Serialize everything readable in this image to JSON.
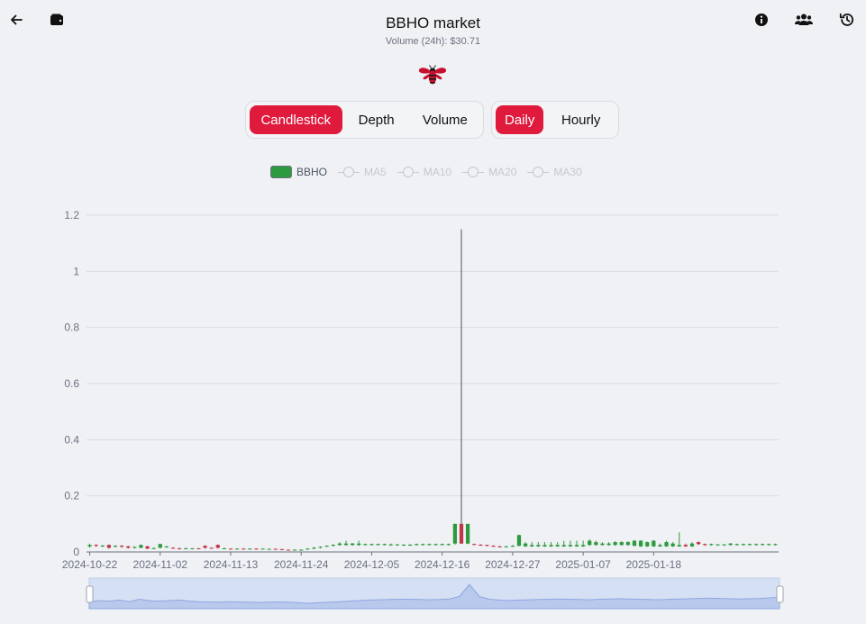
{
  "header": {
    "title": "BBHO market",
    "volume_label": "Volume (24h): $30.71"
  },
  "icons": {
    "back": "arrow-left-icon",
    "wallet": "wallet-icon",
    "info": "info-icon",
    "users": "users-icon",
    "history": "history-icon",
    "logo": "bee-logo-icon"
  },
  "chart_tabs": [
    {
      "label": "Candlestick",
      "active": true
    },
    {
      "label": "Depth",
      "active": false
    },
    {
      "label": "Volume",
      "active": false
    }
  ],
  "interval_tabs": [
    {
      "label": "Daily",
      "active": true
    },
    {
      "label": "Hourly",
      "active": false
    }
  ],
  "legend": [
    {
      "label": "BBHO",
      "active": true
    },
    {
      "label": "MA5",
      "active": false
    },
    {
      "label": "MA10",
      "active": false
    },
    {
      "label": "MA20",
      "active": false
    },
    {
      "label": "MA30",
      "active": false
    }
  ],
  "colors": {
    "accent": "#e01a3c",
    "up": "#2d9a3e",
    "down": "#c2354d"
  },
  "chart_data": {
    "type": "candlestick",
    "y_ticks": [
      "0",
      "0.2",
      "0.4",
      "0.6",
      "0.8",
      "1",
      "1.2"
    ],
    "ylim": [
      0,
      1.2
    ],
    "x_start": "2024-10-22",
    "x_ticks": [
      "2024-10-22",
      "2024-11-02",
      "2024-11-13",
      "2024-11-24",
      "2024-12-05",
      "2024-12-16",
      "2024-12-27",
      "2025-01-07",
      "2025-01-18"
    ],
    "candles": [
      [
        0.02,
        0.025,
        0.03,
        0.015
      ],
      [
        0.025,
        0.022,
        0.028,
        0.018
      ],
      [
        0.02,
        0.023,
        0.025,
        0.017
      ],
      [
        0.025,
        0.015,
        0.027,
        0.012
      ],
      [
        0.02,
        0.022,
        0.024,
        0.016
      ],
      [
        0.022,
        0.02,
        0.025,
        0.015
      ],
      [
        0.02,
        0.015,
        0.022,
        0.012
      ],
      [
        0.015,
        0.018,
        0.02,
        0.012
      ],
      [
        0.015,
        0.025,
        0.027,
        0.013
      ],
      [
        0.02,
        0.012,
        0.022,
        0.01
      ],
      [
        0.012,
        0.014,
        0.016,
        0.01
      ],
      [
        0.015,
        0.028,
        0.03,
        0.013
      ],
      [
        0.018,
        0.02,
        0.022,
        0.015
      ],
      [
        0.015,
        0.014,
        0.017,
        0.012
      ],
      [
        0.013,
        0.012,
        0.015,
        0.01
      ],
      [
        0.012,
        0.013,
        0.015,
        0.01
      ],
      [
        0.012,
        0.013,
        0.014,
        0.01
      ],
      [
        0.013,
        0.012,
        0.014,
        0.01
      ],
      [
        0.022,
        0.015,
        0.024,
        0.012
      ],
      [
        0.015,
        0.014,
        0.016,
        0.012
      ],
      [
        0.025,
        0.015,
        0.027,
        0.012
      ],
      [
        0.012,
        0.013,
        0.015,
        0.01
      ],
      [
        0.012,
        0.011,
        0.013,
        0.009
      ],
      [
        0.011,
        0.012,
        0.013,
        0.009
      ],
      [
        0.012,
        0.011,
        0.013,
        0.009
      ],
      [
        0.011,
        0.012,
        0.013,
        0.009
      ],
      [
        0.012,
        0.011,
        0.013,
        0.009
      ],
      [
        0.011,
        0.012,
        0.013,
        0.009
      ],
      [
        0.01,
        0.011,
        0.012,
        0.008
      ],
      [
        0.011,
        0.01,
        0.012,
        0.008
      ],
      [
        0.01,
        0.009,
        0.011,
        0.007
      ],
      [
        0.008,
        0.007,
        0.009,
        0.006
      ],
      [
        0.006,
        0.008,
        0.009,
        0.005
      ],
      [
        0.006,
        0.008,
        0.009,
        0.005
      ],
      [
        0.01,
        0.012,
        0.013,
        0.008
      ],
      [
        0.012,
        0.015,
        0.018,
        0.01
      ],
      [
        0.015,
        0.018,
        0.02,
        0.013
      ],
      [
        0.02,
        0.022,
        0.024,
        0.018
      ],
      [
        0.022,
        0.025,
        0.028,
        0.02
      ],
      [
        0.025,
        0.03,
        0.035,
        0.022
      ],
      [
        0.025,
        0.03,
        0.04,
        0.022
      ],
      [
        0.025,
        0.03,
        0.032,
        0.022
      ],
      [
        0.025,
        0.03,
        0.04,
        0.022
      ],
      [
        0.026,
        0.028,
        0.03,
        0.023
      ],
      [
        0.025,
        0.028,
        0.03,
        0.023
      ],
      [
        0.026,
        0.028,
        0.03,
        0.023
      ],
      [
        0.025,
        0.028,
        0.03,
        0.023
      ],
      [
        0.025,
        0.027,
        0.03,
        0.022
      ],
      [
        0.025,
        0.027,
        0.028,
        0.022
      ],
      [
        0.025,
        0.026,
        0.028,
        0.022
      ],
      [
        0.025,
        0.026,
        0.028,
        0.022
      ],
      [
        0.026,
        0.028,
        0.03,
        0.023
      ],
      [
        0.026,
        0.028,
        0.03,
        0.023
      ],
      [
        0.026,
        0.028,
        0.03,
        0.023
      ],
      [
        0.026,
        0.028,
        0.03,
        0.023
      ],
      [
        0.026,
        0.028,
        0.03,
        0.023
      ],
      [
        0.026,
        0.028,
        0.03,
        0.023
      ],
      [
        0.03,
        0.1,
        0.1,
        0.026
      ],
      [
        0.1,
        0.03,
        1.15,
        0.028
      ],
      [
        0.03,
        0.1,
        0.1,
        0.028
      ],
      [
        0.028,
        0.027,
        0.03,
        0.025
      ],
      [
        0.026,
        0.025,
        0.028,
        0.022
      ],
      [
        0.025,
        0.022,
        0.026,
        0.02
      ],
      [
        0.022,
        0.02,
        0.024,
        0.018
      ],
      [
        0.02,
        0.018,
        0.022,
        0.016
      ],
      [
        0.018,
        0.02,
        0.022,
        0.016
      ],
      [
        0.02,
        0.022,
        0.025,
        0.018
      ],
      [
        0.022,
        0.06,
        0.062,
        0.02
      ],
      [
        0.02,
        0.03,
        0.035,
        0.018
      ],
      [
        0.02,
        0.025,
        0.035,
        0.018
      ],
      [
        0.02,
        0.025,
        0.035,
        0.018
      ],
      [
        0.02,
        0.025,
        0.035,
        0.018
      ],
      [
        0.02,
        0.025,
        0.035,
        0.018
      ],
      [
        0.02,
        0.025,
        0.035,
        0.018
      ],
      [
        0.02,
        0.025,
        0.04,
        0.018
      ],
      [
        0.02,
        0.025,
        0.04,
        0.018
      ],
      [
        0.02,
        0.025,
        0.04,
        0.018
      ],
      [
        0.02,
        0.025,
        0.04,
        0.018
      ],
      [
        0.025,
        0.04,
        0.045,
        0.022
      ],
      [
        0.025,
        0.035,
        0.04,
        0.022
      ],
      [
        0.025,
        0.03,
        0.035,
        0.022
      ],
      [
        0.025,
        0.03,
        0.035,
        0.022
      ],
      [
        0.025,
        0.035,
        0.038,
        0.022
      ],
      [
        0.025,
        0.035,
        0.038,
        0.022
      ],
      [
        0.025,
        0.035,
        0.038,
        0.022
      ],
      [
        0.022,
        0.04,
        0.042,
        0.02
      ],
      [
        0.02,
        0.04,
        0.042,
        0.018
      ],
      [
        0.02,
        0.035,
        0.037,
        0.018
      ],
      [
        0.02,
        0.04,
        0.042,
        0.018
      ],
      [
        0.02,
        0.025,
        0.03,
        0.018
      ],
      [
        0.02,
        0.035,
        0.04,
        0.018
      ],
      [
        0.02,
        0.03,
        0.035,
        0.018
      ],
      [
        0.02,
        0.025,
        0.07,
        0.018
      ],
      [
        0.025,
        0.02,
        0.03,
        0.018
      ],
      [
        0.02,
        0.03,
        0.035,
        0.018
      ],
      [
        0.035,
        0.028,
        0.037,
        0.025
      ],
      [
        0.028,
        0.025,
        0.03,
        0.022
      ],
      [
        0.025,
        0.028,
        0.03,
        0.022
      ],
      [
        0.025,
        0.027,
        0.028,
        0.022
      ],
      [
        0.025,
        0.027,
        0.028,
        0.022
      ],
      [
        0.025,
        0.03,
        0.032,
        0.022
      ],
      [
        0.026,
        0.028,
        0.03,
        0.023
      ],
      [
        0.026,
        0.028,
        0.03,
        0.023
      ],
      [
        0.026,
        0.028,
        0.03,
        0.023
      ],
      [
        0.026,
        0.028,
        0.03,
        0.023
      ],
      [
        0.026,
        0.028,
        0.03,
        0.023
      ],
      [
        0.026,
        0.028,
        0.03,
        0.023
      ],
      [
        0.026,
        0.028,
        0.03,
        0.023
      ]
    ],
    "volume_overview": [
      0.25,
      0.3,
      0.28,
      0.32,
      0.26,
      0.35,
      0.3,
      0.28,
      0.3,
      0.32,
      0.28,
      0.26,
      0.25,
      0.24,
      0.26,
      0.25,
      0.24,
      0.23,
      0.24,
      0.25,
      0.24,
      0.22,
      0.2,
      0.22,
      0.24,
      0.26,
      0.28,
      0.3,
      0.32,
      0.33,
      0.34,
      0.35,
      0.35,
      0.34,
      0.33,
      0.34,
      0.36,
      0.45,
      0.9,
      0.45,
      0.35,
      0.32,
      0.3,
      0.32,
      0.33,
      0.34,
      0.35,
      0.36,
      0.35,
      0.34,
      0.33,
      0.35,
      0.36,
      0.37,
      0.36,
      0.35,
      0.34,
      0.33,
      0.35,
      0.36,
      0.37,
      0.38,
      0.39,
      0.38,
      0.37,
      0.36,
      0.37,
      0.38,
      0.4,
      0.42
    ]
  }
}
